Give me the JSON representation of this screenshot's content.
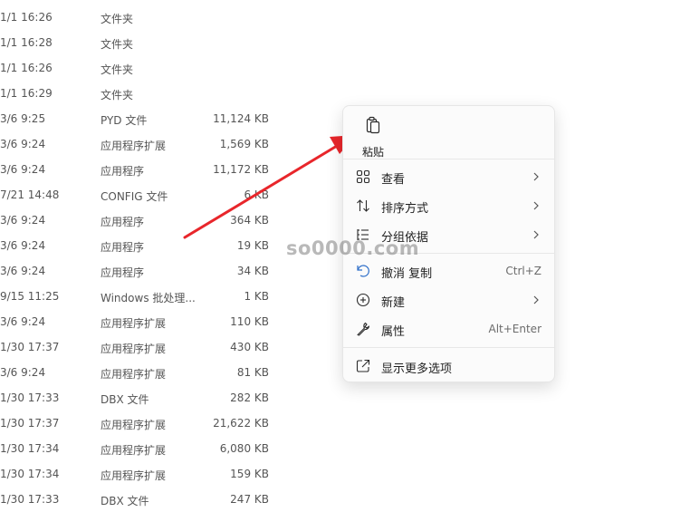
{
  "files": [
    {
      "date": "1/1 16:26",
      "type": "文件夹",
      "size": ""
    },
    {
      "date": "1/1 16:28",
      "type": "文件夹",
      "size": ""
    },
    {
      "date": "1/1 16:26",
      "type": "文件夹",
      "size": ""
    },
    {
      "date": "1/1 16:29",
      "type": "文件夹",
      "size": ""
    },
    {
      "date": "3/6 9:25",
      "type": "PYD 文件",
      "size": "11,124 KB"
    },
    {
      "date": "3/6 9:24",
      "type": "应用程序扩展",
      "size": "1,569 KB"
    },
    {
      "date": "3/6 9:24",
      "type": "应用程序",
      "size": "11,172 KB"
    },
    {
      "date": "7/21 14:48",
      "type": "CONFIG 文件",
      "size": "6 KB"
    },
    {
      "date": "3/6 9:24",
      "type": "应用程序",
      "size": "364 KB"
    },
    {
      "date": "3/6 9:24",
      "type": "应用程序",
      "size": "19 KB"
    },
    {
      "date": "3/6 9:24",
      "type": "应用程序",
      "size": "34 KB"
    },
    {
      "date": "9/15 11:25",
      "type": "Windows 批处理...",
      "size": "1 KB"
    },
    {
      "date": "3/6 9:24",
      "type": "应用程序扩展",
      "size": "110 KB"
    },
    {
      "date": "1/30 17:37",
      "type": "应用程序扩展",
      "size": "430 KB"
    },
    {
      "date": "3/6 9:24",
      "type": "应用程序扩展",
      "size": "81 KB"
    },
    {
      "date": "1/30 17:33",
      "type": "DBX 文件",
      "size": "282 KB"
    },
    {
      "date": "1/30 17:37",
      "type": "应用程序扩展",
      "size": "21,622 KB"
    },
    {
      "date": "1/30 17:34",
      "type": "应用程序扩展",
      "size": "6,080 KB"
    },
    {
      "date": "1/30 17:34",
      "type": "应用程序扩展",
      "size": "159 KB"
    },
    {
      "date": "1/30 17:33",
      "type": "DBX 文件",
      "size": "247 KB"
    }
  ],
  "context_menu": {
    "paste_label": "粘贴",
    "view_label": "查看",
    "sort_label": "排序方式",
    "group_label": "分组依据",
    "undo_label": "撤消 复制",
    "undo_shortcut": "Ctrl+Z",
    "new_label": "新建",
    "properties_label": "属性",
    "properties_shortcut": "Alt+Enter",
    "more_options_label": "显示更多选项"
  },
  "watermark": "so0000.com",
  "colors": {
    "arrow": "#e8262b",
    "icon": "#2b2b2b",
    "menu_bg": "#fbfbfb"
  },
  "icons": [
    "paste-icon",
    "view-icon",
    "sort-icon",
    "group-icon",
    "undo-icon",
    "new-icon",
    "properties-icon",
    "more-options-icon",
    "chevron-right-icon"
  ]
}
